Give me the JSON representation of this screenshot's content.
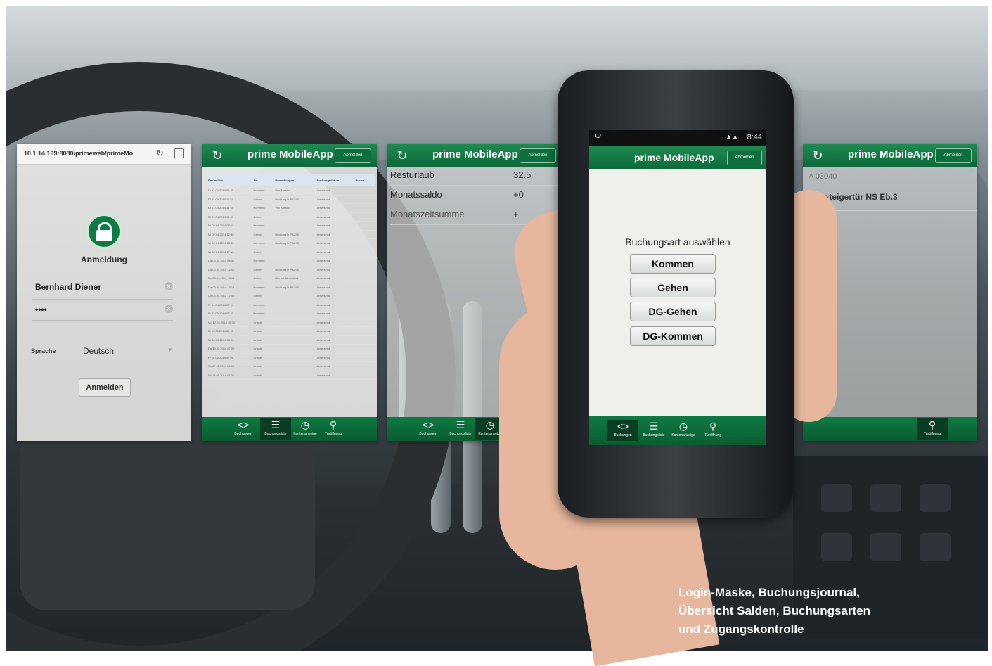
{
  "login": {
    "url": "10.1.14.199:8080/primeweb/primeMo",
    "title": "Anmeldung",
    "username": "Bernhard Diener",
    "password": "••••",
    "sprache_label": "Sprache",
    "sprache_value": "Deutsch",
    "anmelden_button": "Anmelden"
  },
  "journal": {
    "app_title": "prime MobileApp",
    "abmelden": "Abmelden",
    "headers": [
      "Datum Zeit",
      "Art",
      "Bemerkungen",
      "Buchungsdatum",
      "Buchu..."
    ],
    "rows": [
      [
        "Di 01.04.2014 05:31",
        "Kommen",
        "Von Aussen",
        "Anwesend"
      ],
      [
        "Di 01.04.2014 11:25",
        "Gehen",
        "Buchung in PAUSE",
        "Anwesend"
      ],
      [
        "Di 01.04.2014 14:54",
        "Kommen",
        "Von Aussen",
        "Anwesend"
      ],
      [
        "Di 01.04.2014 15:07",
        "Gehen",
        "",
        "Anwesend"
      ],
      [
        "Mi 02.04.2014 06:15",
        "Kommen",
        "",
        "Anwesend"
      ],
      [
        "Mi 02.04.2014 12:30",
        "Gehen",
        "Buchung in PAUSE",
        "Anwesend"
      ],
      [
        "Mi 02.04.2014 13:00",
        "Kommen",
        "Buchung in PAUSE",
        "Anwesend"
      ],
      [
        "Mi 02.04.2014 17:10",
        "Gehen",
        "",
        "Anwesend"
      ],
      [
        "Do 03.04.2014 06:57",
        "Kommen",
        "",
        "Anwesend"
      ],
      [
        "Do 03.04.2014 12:00",
        "Gehen",
        "Buchung in PAUSE",
        "Abwesend"
      ],
      [
        "Do 03.04.2014 13:14",
        "Gehen",
        "Dienstl. Abwesend",
        "Anwesend"
      ],
      [
        "Do 03.04.2014 13:14",
        "Kommen",
        "Buchung in PAUSE",
        "Anwesend"
      ],
      [
        "Do 03.04.2014 17:08",
        "Gehen",
        "",
        "Anwesend"
      ],
      [
        "Fr 04.04.2014 07:14",
        "Kommen",
        "",
        "Anwesend"
      ],
      [
        "Fr 02.05.2014 07:30",
        "Kommen",
        "",
        "Anwesend"
      ],
      [
        "Mo 12.05.2014 10:30",
        "Urlaub",
        "",
        "Anwesend"
      ],
      [
        "Di 13.05.2014 07:00",
        "Urlaub",
        "",
        "Anwesend"
      ],
      [
        "Mi 14.05.2014 08:00",
        "Urlaub",
        "",
        "Anwesend"
      ],
      [
        "Do 15.05.2014 07:00",
        "Urlaub",
        "",
        "Anwesend"
      ],
      [
        "Fr 16.05.2014 07:00",
        "Urlaub",
        "",
        "Anwesend"
      ],
      [
        "Sa 17.05.2014 08:00",
        "Urlaub",
        "",
        "Anwesend"
      ],
      [
        "So 18.05.2014 07:00",
        "Urlaub",
        "",
        "Anwesend"
      ]
    ],
    "nav": [
      "Buchungen",
      "Buchungsliste",
      "Kontenanzeige",
      "Türöffnung"
    ]
  },
  "salden": {
    "app_title": "prime MobileApp",
    "abmelden": "Abmelden",
    "rows": [
      {
        "label": "Resturlaub",
        "value": "32.5"
      },
      {
        "label": "Monatssaldo",
        "value": "+0"
      },
      {
        "label": "Monatszeitsumme",
        "value": "+"
      }
    ],
    "nav": [
      "Buchungen",
      "Buchungsliste",
      "Kontenanzeige"
    ]
  },
  "phone": {
    "time": "8:44",
    "app_title": "prime MobileApp",
    "abmelden": "Abmelden",
    "heading": "Buchungsart auswählen",
    "buttons": [
      "Kommen",
      "Gehen",
      "DG-Gehen",
      "DG-Kommen"
    ],
    "nav": [
      "Buchungen",
      "Buchungsliste",
      "Kontenanzeige",
      "Türöffnung"
    ]
  },
  "zugang": {
    "app_title": "prime MobileApp",
    "abmelden": "Abmelden",
    "line1": "A 03040",
    "line2": "Aussteigertür NS Eb.3",
    "nav_last": "Türöffnung"
  },
  "caption": {
    "line1": "Login-Maske, Buchungsjournal,",
    "line2": "Übersicht Salden, Buchungsarten",
    "line3": "und Zugangskontrolle"
  },
  "colors": {
    "brand_green": "#0d6a3a",
    "caption_text": "#ffffff"
  }
}
